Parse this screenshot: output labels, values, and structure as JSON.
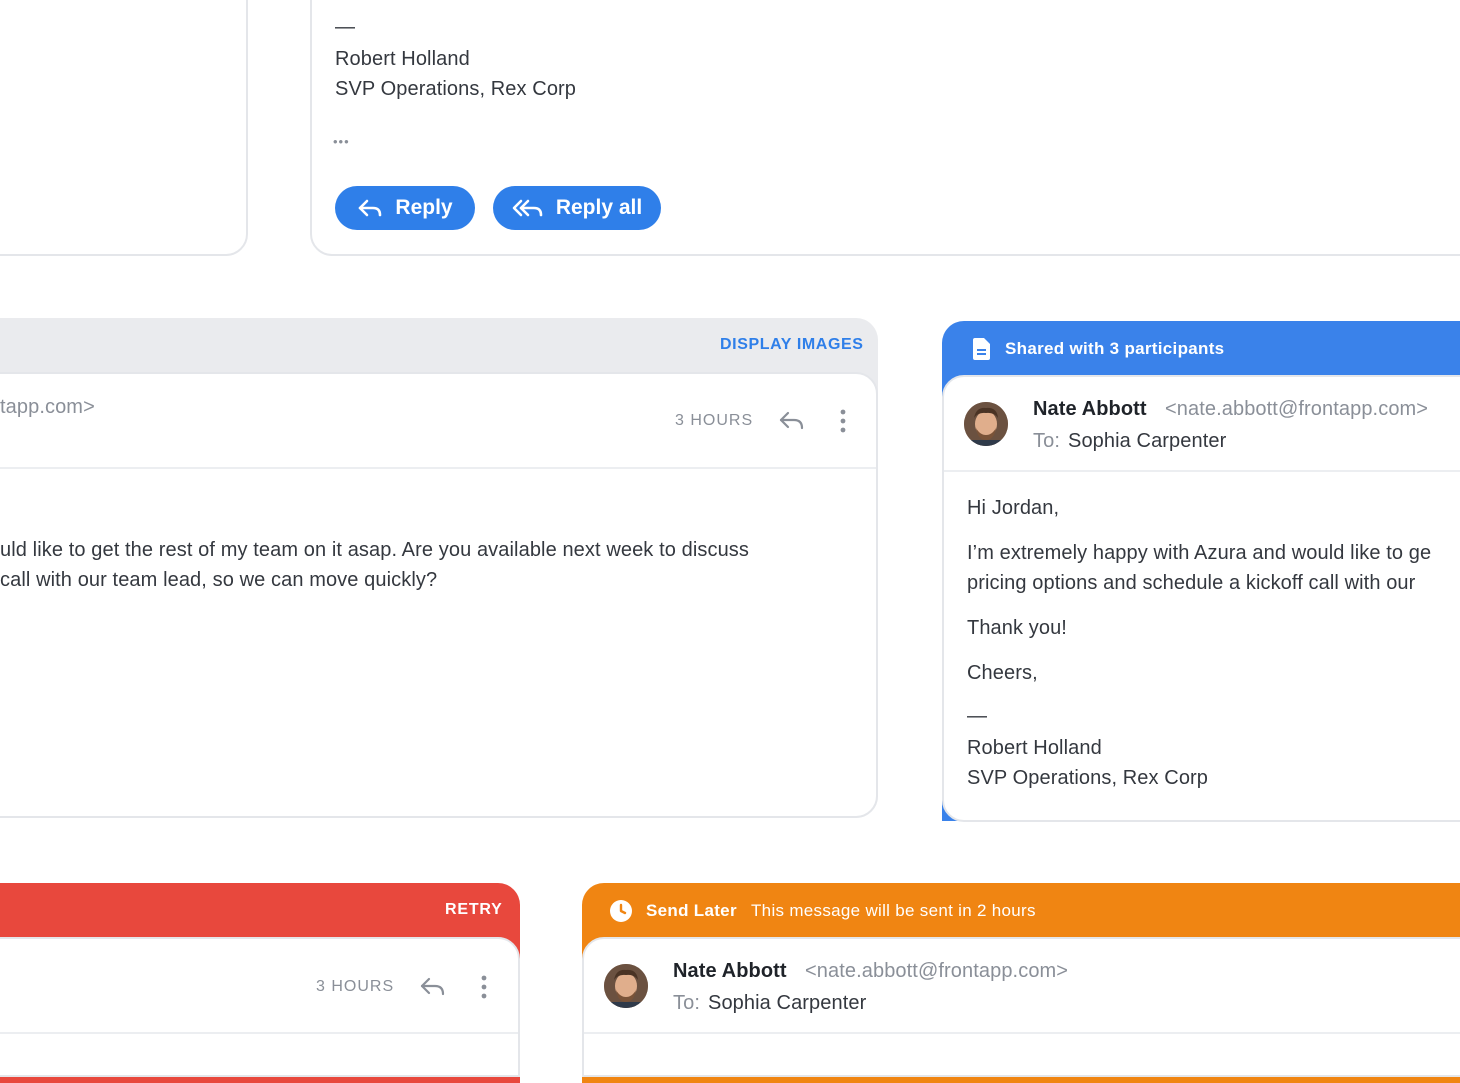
{
  "top_card": {
    "sig_dash": "—",
    "sig_name": "Robert Holland",
    "sig_title": "SVP Operations, Rex Corp",
    "more": "•••",
    "reply_label": "Reply",
    "reply_all_label": "Reply all"
  },
  "middle_card": {
    "banner_action": "DISPLAY IMAGES",
    "from_email_fragment": "tapp.com>",
    "time": "3 HOURS",
    "body_line1": "uld like to get the rest of my team on it asap. Are you available next week to discuss",
    "body_line2": "call with our team lead, so we can move quickly?"
  },
  "shared_card": {
    "banner_label": "Shared with 3 participants",
    "sender_name": "Nate Abbott",
    "sender_email": "<nate.abbott@frontapp.com>",
    "to_prefix": "To:",
    "to_name": "Sophia Carpenter",
    "greeting": "Hi Jordan,",
    "body_line1": "I’m extremely happy with Azura and would like to ge",
    "body_line2": "pricing options and schedule a kickoff call with our",
    "thanks": "Thank you!",
    "closing": "Cheers,",
    "sig_dash": "—",
    "sig_name": "Robert Holland",
    "sig_title": "SVP Operations, Rex Corp"
  },
  "error_card": {
    "banner_action": "RETRY",
    "time": "3 HOURS"
  },
  "send_later_card": {
    "banner_title": "Send Later",
    "banner_text": "This message will be sent in 2 hours",
    "sender_name": "Nate Abbott",
    "sender_email": "<nate.abbott@frontapp.com>",
    "to_prefix": "To:",
    "to_name": "Sophia Carpenter"
  },
  "colors": {
    "accent_blue": "#2f7fe9",
    "shared_banner": "#3a82ea",
    "error_red": "#e8483d",
    "send_later_orange": "#f08512",
    "grey_banner": "#eaebee"
  },
  "icons": [
    "reply-icon",
    "reply-all-icon",
    "more-vertical-icon",
    "document-icon",
    "clock-icon",
    "avatar"
  ]
}
